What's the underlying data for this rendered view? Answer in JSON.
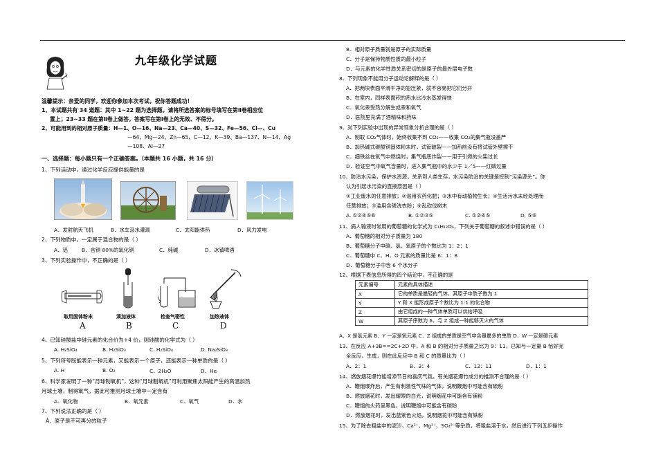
{
  "header": {
    "title": "九年级化学试题"
  },
  "notice": {
    "line1": "温馨提示：亲爱的同学，欢迎你参加本次考试，祝你答题成功！",
    "line2": "1、本试题共有 34 道题：其中 1~22 题为选择题，请将所选答案的标号填写在第Ⅱ卷相应位",
    "line3": "置上；23~33 题在第Ⅱ卷上做答，答案写在第Ⅰ卷上的无效、不得分。",
    "line4": "2、可能用到的相对原子质量：H—1、O—16、Na—23、Ca—40、S—32、Fe—56、Cl—、Cu",
    "line5": "—64、Mg—24、Zn—65、C—12、K—39、Ba—137、N—14、Ag",
    "line6": "—108、Al—27"
  },
  "section1": {
    "heading": "一、选择题：每小题只有一个正确答案。（本题共 16 小题，共 16 分）"
  },
  "left_questions": {
    "q1": "1、下列活动中，通过化学反应提供能量的是",
    "q1_opts": [
      "A．发射航天飞机",
      "B．水车汲水灌溉",
      "C．太阳能供热",
      "D．风力发电"
    ],
    "q2": "2、下列物质中，一定属于混合物的是（            ）",
    "q2_opts": [
      "A．铝",
      "B．含铜 80%的氧化铜",
      "C．纯碱",
      "D．冰镇啤酒"
    ],
    "q3": "3、下列实验操作中，不正确的是（            ）",
    "q3_labels": [
      "取用固体粉末",
      "滴加液体",
      "检查气密性",
      "加热液体"
    ],
    "q3_letters": [
      "A",
      "B",
      "C",
      "D"
    ],
    "q4": "4、已知硅酸盐中硅元素的化合价为+4 价，则硅酸的化学式为（            ）",
    "q4_opts": [
      "A. H₂SiO₄",
      "B. H₂SiO₃",
      "C. H₂SiO₄",
      "D. Na₂SiO₃"
    ],
    "q5": "5、下列符号既能表示一种元素，又能表示一个原子，还能表示一种单质的是（            ）",
    "q5_opts": [
      "A. H",
      "B. O₂",
      "C．2H₂O",
      "D．He"
    ],
    "q6a": "6、科学家发明了一种“月球制氧机”，这种“月球制氧机”可利用聚焦太阳能产生的高温加热",
    "q6b": "月球土壤，制得氧气。据此可推测月球土壤中一定含有",
    "q6_opts": [
      "A．氧化物",
      "B．氧元素",
      "C．氧气",
      "D．水"
    ],
    "q7": "7、下列说法正确的是（            ）",
    "q7a": "A．原子是不可再分的粒子"
  },
  "right_questions": {
    "q7b": "B．相对原子质量就是原子的实际质量",
    "q7c": "C．分子是保持物质性质的最小粒子",
    "q7d": "D．与元素的化学性质关系密切的是原子的最外层电子数",
    "q8": "8、下列现象不能用分子运动论解释的是（            ）",
    "q8a": "A．把两块表面平滑干净的铅压紧，就不容易把它们分开",
    "q8b": "B．在室内，同样表面积的热水比冷水蒸发得快",
    "q8c": "C．氧化汞受热分解生成汞和氧气",
    "q8d": "D．医院里充满了酒精味和药味",
    "q9": "9、对下列实验中出现的异常现象分析合理的是（            ）",
    "q9a": "A．制取 CO₂气体时，始终收集不到 CO₂——收集 CO₂的集气瓶没盖严",
    "q9b": "B．加热碱式碳酸铜固体粉末时，试管破裂——加热前没有将试管外壁擦干",
    "q9c": "C．细铁丝在氧气中燃烧时，集气瓶底炸裂——用于引燃的火柴过长",
    "q9d": "D．验证空气中氧气含量时，进入集气瓶中的水少于 1／5——红磷过量",
    "q10a": "10、防治水污染，保护水资源，关系到人类生存，水污染防治的关键是控制“污染源头”。你",
    "q10b": "认为引起水污染的直接原因是（            ）",
    "q10c": "①工业废水的任意排放；②滥用农药化肥；③水中有动植物生长；④生活污水未经处理而",
    "q10d": "任意排放；⑤滥用含磷洗衣粉；⑥乱砍伐树木",
    "q10_opts": [
      "A. ①②④⑤⑥",
      "B. ①②③⑤",
      "C. ①②④⑤",
      "D. ⑤⑥"
    ],
    "q11": "11、病人输液时常用的葡萄糖的化学式为 C₆H₁₂O₆，下列关于葡萄糖的叙述中错误的是（    ）",
    "q11a": "A．葡萄糖的相对分子质量为 180",
    "q11b": "B．葡萄糖分子中碳、氢、氧原子的个数比为 1：2：1",
    "q11c": "C．葡萄糖中 C、H、O 元素的质量比是 6：1：8",
    "q11d": "D．葡萄糖分子中含 6 个水分子",
    "q12": "12、根据下表信息所得的四个结论中，不正确的是",
    "table_head": [
      "元素编号",
      "元素的具体描述"
    ],
    "table_rows": [
      [
        "X",
        "它的单质是最轻的气体，其原子中质子数为 1"
      ],
      [
        "Y",
        "Y 和 X 能形成原子个数比为 1:1 的化合物"
      ],
      [
        "Z",
        "由它组成的一种气体单质可以供给呼吸"
      ],
      [
        "W",
        "其原子序数为 6，与 Z 组成一种能够灭火的气体"
      ]
    ],
    "q12_ans": "A．X 是氢元素   B．Y 一定是氧元素   C．Z 组成的单质是空气中含量最多的单质 D．W 一定是碳元素",
    "q13a": "13、在反应 A+3B==2C+2D 中，A 和 B 的相对分子质量之比为 9：11，已知与一定量 B 恰好完",
    "q13b": "全反应，生成，则在此反应中 B 和 C 的质量比为（            ）",
    "q13_opts": [
      "A．2：1",
      "B．3：4",
      "C．12：11",
      "D．1：1"
    ],
    "q14": "14、燃放烟花爆竹能增添节日的喜庆气氛。有关烟花爆竹成分的推测不合理的是（            ）",
    "q14a": "A．鞭炮爆炸后，产生有刺激性气味的气体，说明鞭炮中可能含有硫粉",
    "q14b": "B．燃放烟花时，发出耀眼的白光，说明烟花中可能含有镁粉",
    "q14c": "C．鞭炮的火药呈黑色，说明鞭炮中可能含有碳粉",
    "q14d": "D．燃放烟花时，发出蓝紫色火焰，说明烟花中可能含有铁粉",
    "q15": "15、为了除去粗盐中的泥沙、Ca²⁺、Mg²⁺、SO₄²⁻等杂质，将粗盐溶于水，然后进行下列五步操作"
  },
  "colors": {
    "text": "#111111",
    "rule": "#333333"
  }
}
